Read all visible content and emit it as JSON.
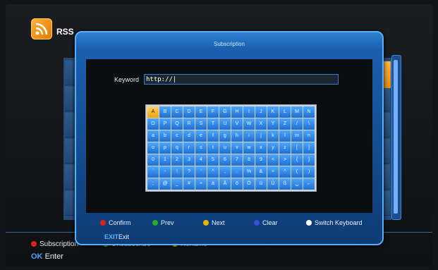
{
  "app": {
    "title": "RSS"
  },
  "dialog": {
    "title": "Subscription",
    "keyword_label": "Keyword",
    "keyword_value": "http://|",
    "keyboard_rows": [
      [
        "A",
        "B",
        "C",
        "D",
        "E",
        "F",
        "G",
        "H",
        "I",
        "J",
        "K",
        "L",
        "M",
        "N"
      ],
      [
        "O",
        "P",
        "Q",
        "R",
        "S",
        "T",
        "U",
        "V",
        "W",
        "X",
        "Y",
        "Z",
        "/",
        "\\"
      ],
      [
        "a",
        "b",
        "c",
        "d",
        "e",
        "f",
        "g",
        "h",
        "i",
        "j",
        "k",
        "l",
        "m",
        "n"
      ],
      [
        "o",
        "p",
        "q",
        "r",
        "s",
        "t",
        "u",
        "v",
        "w",
        "x",
        "y",
        "z",
        "[",
        "]"
      ],
      [
        "0",
        "1",
        "2",
        "3",
        "4",
        "5",
        "6",
        "7",
        "8",
        "9",
        "<",
        ">",
        "{",
        "}"
      ],
      [
        "`",
        "-",
        "!",
        "?",
        "'",
        "^",
        ",",
        ".",
        "%",
        "&",
        "=",
        "^",
        "(",
        ")"
      ],
      [
        ";",
        "@",
        "_",
        "#",
        "+",
        "ä",
        "Å",
        "ö",
        "Ö",
        "ü",
        "Ü",
        "ß",
        "␣",
        "←"
      ]
    ],
    "selected_key": "A",
    "footer": [
      {
        "label": "Confirm",
        "color": "#e02020"
      },
      {
        "label": "Prev",
        "color": "#22b022"
      },
      {
        "label": "Next",
        "color": "#e6b800"
      },
      {
        "label": "Clear",
        "color": "#3a4fe0"
      },
      {
        "label": "Switch Keyboard",
        "color": "#ffffff"
      }
    ],
    "exit_key": "EXIT",
    "exit_label": "Exit"
  },
  "background_legend": [
    {
      "label": "Subscription",
      "color": "#e02020"
    },
    {
      "label": "Unsubscribe",
      "color": "#22b022"
    },
    {
      "label": "Rename",
      "color": "#e6b800"
    }
  ],
  "ok_key": "OK",
  "ok_label": "Enter",
  "scroll": {
    "position": "top"
  }
}
